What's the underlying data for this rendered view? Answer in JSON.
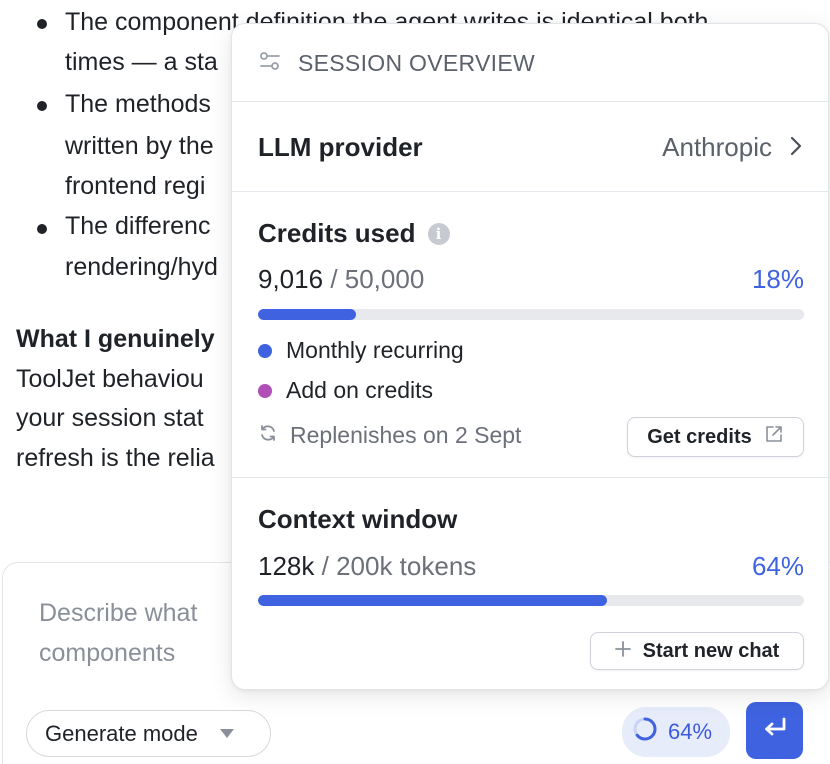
{
  "chat": {
    "bullets": [
      {
        "lines": [
          "The component definition the agent writes is identical both",
          "times — a sta"
        ]
      },
      {
        "lines": [
          "The methods",
          "written by the",
          "frontend regi"
        ]
      },
      {
        "lines": [
          "The differenc",
          "rendering/hyd"
        ]
      }
    ],
    "paragraph": {
      "heading": "What I genuinely",
      "lines": [
        "ToolJet behaviou",
        "your session stat",
        "refresh is the relia"
      ]
    }
  },
  "composer": {
    "placeholder": "Describe what you want to build, or @mention components",
    "placeholder_visible_1": "Describe what",
    "placeholder_visible_2": "components",
    "mode_label": "Generate mode",
    "context_pct": "64%"
  },
  "session": {
    "header_title": "SESSION OVERVIEW",
    "provider_label": "LLM provider",
    "provider_value": "Anthropic",
    "credits": {
      "title": "Credits used",
      "used": "9,016",
      "total": "/ 50,000",
      "percent_label": "18%",
      "fill_pct": 18,
      "legend": [
        {
          "label": "Monthly recurring",
          "color": "#3f63e0"
        },
        {
          "label": "Add on credits",
          "color": "#b04fb5"
        }
      ],
      "replenish_text": "Replenishes on 2 Sept",
      "get_credits_label": "Get credits"
    },
    "context": {
      "title": "Context window",
      "used": "128k",
      "total": "/ 200k tokens",
      "percent_label": "64%",
      "fill_pct": 64,
      "new_chat_label": "Start new chat"
    }
  }
}
